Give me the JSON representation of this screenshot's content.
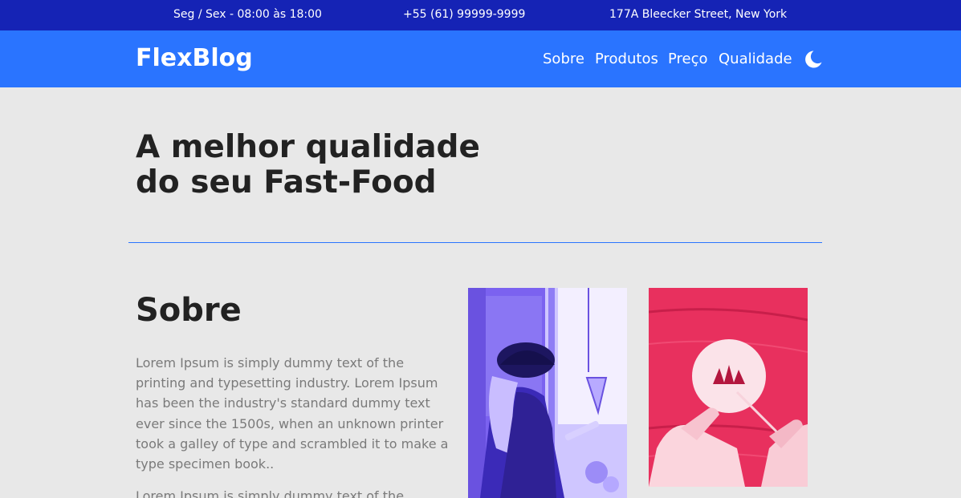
{
  "topbar": {
    "hours": "Seg / Sex - 08:00 às 18:00",
    "phone": "+55 (61) 99999-9999",
    "address": "177A Bleecker Street, New York"
  },
  "navbar": {
    "logo": "FlexBlog",
    "links": [
      "Sobre",
      "Produtos",
      "Preço",
      "Qualidade"
    ],
    "theme_icon": "moon-icon"
  },
  "hero": {
    "title_line1": "A melhor qualidade",
    "title_line2": "do seu Fast-Food"
  },
  "about": {
    "title": "Sobre",
    "paragraph1": "Lorem Ipsum is simply dummy text of the printing and typesetting industry. Lorem Ipsum has been the industry's standard dummy text ever since the 1500s, when an unknown printer took a galley of type and scrambled it to make a type specimen book..",
    "paragraph2": "Lorem Ipsum is simply dummy text of the"
  },
  "colors": {
    "topbar": "#1523b5",
    "navbar": "#2a74ff",
    "background": "#e8e8e8",
    "photo1_tint": "#7b62f0",
    "photo2_tint": "#e8305e"
  }
}
